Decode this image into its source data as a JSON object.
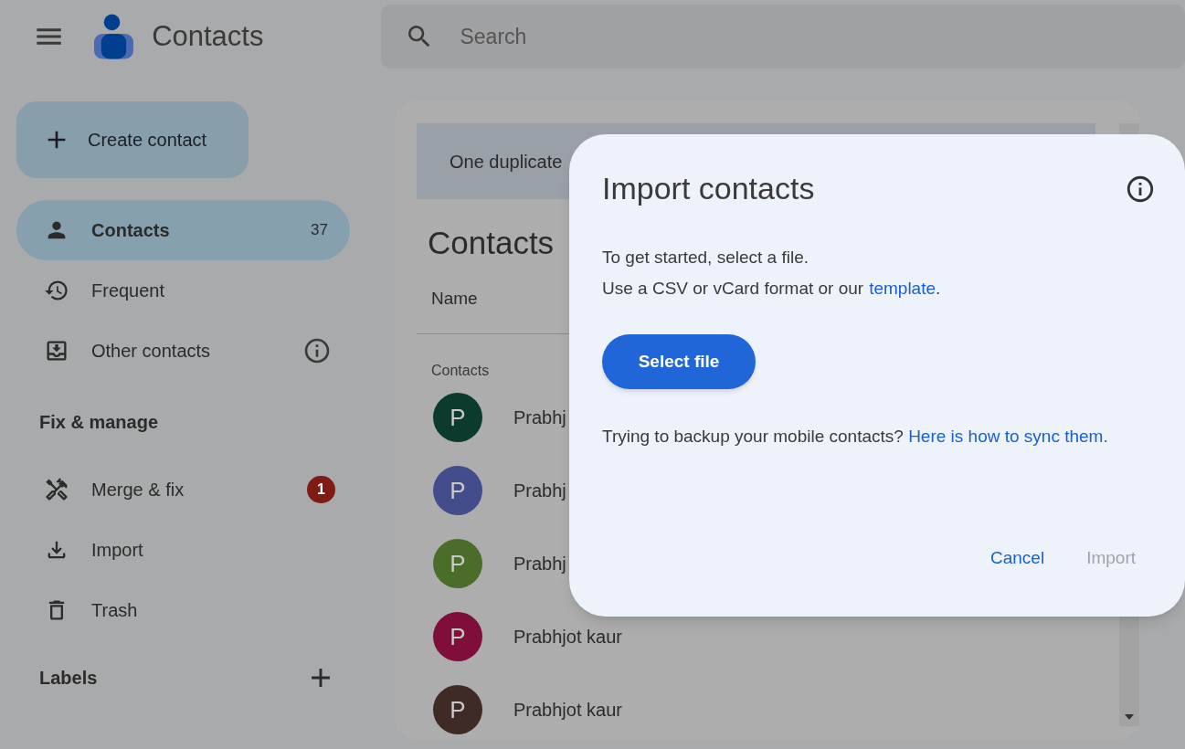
{
  "app": {
    "title": "Contacts"
  },
  "search": {
    "placeholder": "Search"
  },
  "create_button": {
    "label": "Create contact"
  },
  "nav": [
    {
      "kind": "person",
      "label": "Contacts",
      "count": "37",
      "selected": true
    },
    {
      "kind": "history",
      "label": "Frequent",
      "selected": false
    },
    {
      "kind": "inbox",
      "label": "Other contacts",
      "info": true,
      "selected": false
    }
  ],
  "fix_section": {
    "title": "Fix & manage"
  },
  "fix_items": [
    {
      "kind": "tools",
      "label": "Merge & fix",
      "badge": "1",
      "selected": false
    },
    {
      "kind": "download",
      "label": "Import",
      "selected": false
    },
    {
      "kind": "trash",
      "label": "Trash",
      "selected": false
    }
  ],
  "labels_section": {
    "title": "Labels"
  },
  "main": {
    "banner": "One duplicate",
    "heading": "Contacts",
    "column": "Name",
    "group": "Contacts",
    "rows": [
      {
        "initial": "P",
        "name": "Prabhj",
        "color": "#0b3a2e"
      },
      {
        "initial": "P",
        "name": "Prabhj",
        "color": "#434d8c"
      },
      {
        "initial": "P",
        "name": "Prabhj",
        "color": "#4a6d2a"
      },
      {
        "initial": "P",
        "name": "Prabhjot kaur",
        "color": "#7f0f3a"
      },
      {
        "initial": "P",
        "name": "Prabhjot kaur",
        "color": "#3f2b26"
      }
    ]
  },
  "dialog": {
    "title": "Import contacts",
    "line1": "To get started, select a file.",
    "line2": "Use a CSV or vCard format or our",
    "line2_link": "template",
    "line2_end": ".",
    "select_button": "Select file",
    "help": "Trying to backup your mobile contacts?",
    "help_link": "Here is how to sync them.",
    "cancel": "Cancel",
    "import": {
      "label": "Import",
      "disabled": true
    }
  }
}
